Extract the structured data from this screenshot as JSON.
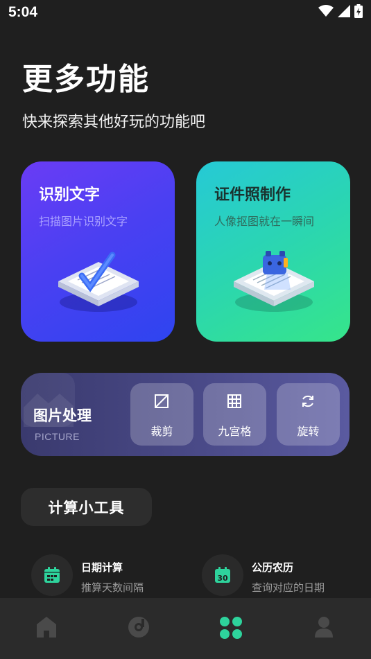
{
  "status": {
    "time": "5:04"
  },
  "page": {
    "title": "更多功能",
    "subtitle": "快来探索其他好玩的功能吧"
  },
  "cards": [
    {
      "title": "识别文字",
      "desc": "扫描图片识别文字"
    },
    {
      "title": "证件照制作",
      "desc": "人像抠图就在一瞬间"
    }
  ],
  "picture": {
    "title": "图片处理",
    "subtitle": "PICTURE",
    "tools": [
      {
        "label": "裁剪",
        "icon": "crop-icon"
      },
      {
        "label": "九宫格",
        "icon": "grid-icon"
      },
      {
        "label": "旋转",
        "icon": "rotate-icon"
      }
    ]
  },
  "calc": {
    "title": "计算小工具",
    "items": [
      {
        "name": "日期计算",
        "desc": "推算天数间隔",
        "icon": "calendar-icon"
      },
      {
        "name": "公历农历",
        "desc": "查询对应的日期",
        "icon": "calendar-30-icon",
        "badge": "30"
      }
    ]
  },
  "tabs": [
    {
      "icon": "home-icon",
      "active": false
    },
    {
      "icon": "music-disc-icon",
      "active": false
    },
    {
      "icon": "apps-grid-icon",
      "active": true
    },
    {
      "icon": "profile-icon",
      "active": false
    }
  ],
  "colors": {
    "accent": "#2ed39c",
    "background": "#1f1f1f",
    "tab_inactive": "#4a4a4a"
  }
}
